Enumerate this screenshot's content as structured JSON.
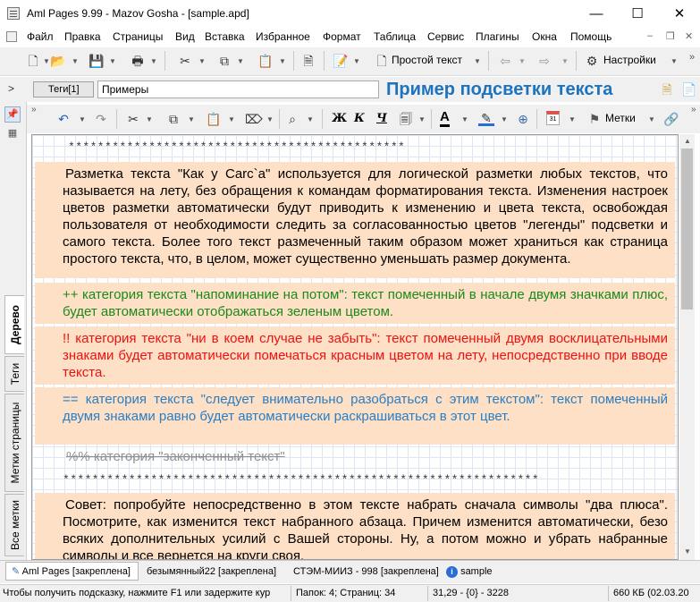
{
  "window": {
    "title": "Aml Pages 9.99 - Mazov Gosha - [sample.apd]",
    "minimize": "—",
    "maximize": "☐",
    "close": "✕"
  },
  "menu": [
    "Файл",
    "Правка",
    "Страницы",
    "Вид",
    "Вставка",
    "Избранное",
    "Формат",
    "Таблица",
    "Сервис",
    "Плагины",
    "Окна",
    "Помощь"
  ],
  "mdi": {
    "min": "–",
    "restore": "❐",
    "close": "✕"
  },
  "toolbar": {
    "text_mode": "Простой текст",
    "settings": "Настройки"
  },
  "nav": {
    "tags_button": "Теги[1]",
    "breadcrumb_value": "Примеры",
    "page_title": "Пример подсветки текста"
  },
  "side_tabs": {
    "tree": "Дерево",
    "tags": "Теги",
    "page_marks": "Метки страницы",
    "all_marks": "Все метки"
  },
  "edit_toolbar": {
    "bold": "Ж",
    "italic": "К",
    "underline": "Ч",
    "font_color": "A",
    "marks": "Метки",
    "date_badge": "31"
  },
  "document": {
    "stars_top": "**********************************************",
    "para_intro": "Разметка текста \"Как у Carc`a\" используется для логической разметки любых текстов, что называется на лету, без обращения к командам форматирования текста. Изменения настроек цветов разметки автоматически будут приводить к изменению и цвета текста, освобождая пользователя от необходимости следить за согласованностью цветов \"легенды\" подсветки и самого текста. Более того текст размеченный таким образом может храниться как страница простого текста, что, в целом, может существенно уменьшать размер документа.",
    "para_green": "++ категория текста \"напоминание на потом\": текст помеченный в начале двумя значками плюс, будет автоматически отображаться зеленым цветом.",
    "para_red": "!!    категория текста   \"ни в коем случае не забыть\": текст помеченный двумя восклицательными знаками будет автоматически помечаться красным цветом на лету, непосредственно при вводе текста.",
    "para_blue": "== категория текста \"следует внимательно разобраться с этим текстом\": текст помеченный двумя знаками равно будет автоматически раскрашиваться в этот цвет.",
    "para_done": "%% категория \"законченный текст\"",
    "stars_mid": "*****************************************************************",
    "para_tip": "Совет: попробуйте непосредственно в этом тексте набрать сначала символы \"два плюса\". Посмотрите, как изменится текст набранного абзаца. Причем изменится автоматически, безо всяких дополнительных усилий с Вашей стороны. Ну, а потом можно и убрать набранные символы и все вернется на круги своя."
  },
  "bottom_tabs": [
    {
      "label": "Aml Pages [закреплена]",
      "icon": "pencil-icon"
    },
    {
      "label": "безымянный22 [закреплена]"
    },
    {
      "label": "СТЭМ-МИИЗ - 998 [закреплена]"
    },
    {
      "label": "sample",
      "icon": "info-icon"
    }
  ],
  "status": {
    "hint": "Чтобы получить подсказку, нажмите F1 или задержите кур",
    "folders": "Папок: 4; Страниц: 34",
    "position": "31,29 - {0} - 3228",
    "size": "660 КБ (02.03.20"
  },
  "colors": {
    "highlight_bg": "#fde0c6",
    "green": "#1b8a1b",
    "red": "#ee1111",
    "blue": "#2a7ec4",
    "title_blue": "#1e73be"
  }
}
